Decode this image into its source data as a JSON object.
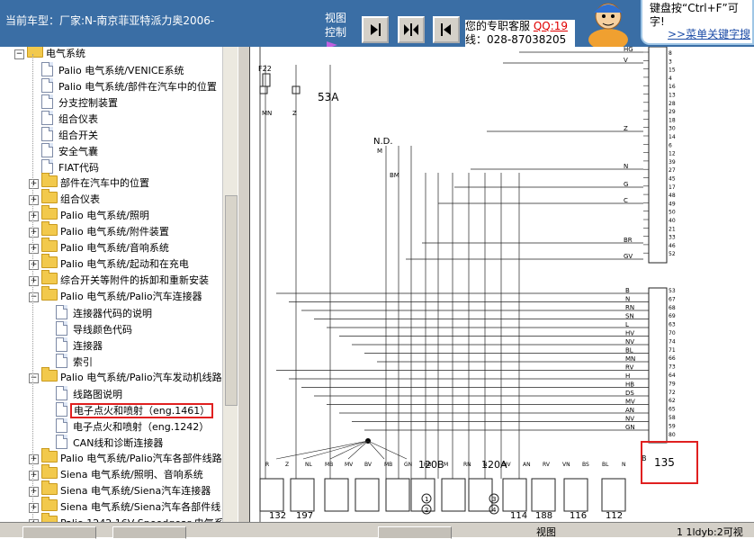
{
  "header": {
    "vehicle_label": "当前车型：厂家:N-南京菲亚特派力奥2006-",
    "view_control_label": "视图\n控制",
    "contact_line1": "您的专职客服",
    "contact_qq": "QQ:19",
    "contact_line2": "线：028-87038205",
    "help_text": "键盘按“Ctrl+F”可",
    "help_text2": "字!",
    "help_link": ">>菜单关键字搜"
  },
  "tree": [
    {
      "label": "电气系统",
      "type": "folder",
      "level": 0,
      "expanded": true
    },
    {
      "label": "Palio 电气系统/VENICE系统",
      "type": "doc",
      "level": 1
    },
    {
      "label": "Palio 电气系统/部件在汽车中的位置",
      "type": "doc",
      "level": 1
    },
    {
      "label": "分支控制装置",
      "type": "doc",
      "level": 1
    },
    {
      "label": "组合仪表",
      "type": "doc",
      "level": 1
    },
    {
      "label": "组合开关",
      "type": "doc",
      "level": 1
    },
    {
      "label": "安全气囊",
      "type": "doc",
      "level": 1
    },
    {
      "label": "FIAT代码",
      "type": "doc",
      "level": 1
    },
    {
      "label": "部件在汽车中的位置",
      "type": "folder",
      "level": 1,
      "expanded": false
    },
    {
      "label": "组合仪表",
      "type": "folder",
      "level": 1,
      "expanded": false
    },
    {
      "label": "Palio 电气系统/照明",
      "type": "folder",
      "level": 1,
      "expanded": false
    },
    {
      "label": "Palio 电气系统/附件装置",
      "type": "folder",
      "level": 1,
      "expanded": false
    },
    {
      "label": "Palio 电气系统/音响系统",
      "type": "folder",
      "level": 1,
      "expanded": false
    },
    {
      "label": "Palio 电气系统/起动和在充电",
      "type": "folder",
      "level": 1,
      "expanded": false
    },
    {
      "label": "综合开关等附件的拆卸和重新安装",
      "type": "folder",
      "level": 1,
      "expanded": false
    },
    {
      "label": "Palio 电气系统/Palio汽车连接器",
      "type": "folder",
      "level": 1,
      "expanded": true
    },
    {
      "label": "连接器代码的说明",
      "type": "doc",
      "level": 2
    },
    {
      "label": "导线颜色代码",
      "type": "doc",
      "level": 2
    },
    {
      "label": "连接器",
      "type": "doc",
      "level": 2
    },
    {
      "label": "索引",
      "type": "doc",
      "level": 2
    },
    {
      "label": "Palio 电气系统/Palio汽车发动机线路",
      "type": "folder",
      "level": 1,
      "expanded": true
    },
    {
      "label": "线路图说明",
      "type": "doc",
      "level": 2
    },
    {
      "label": "电子点火和喷射（eng.1461）",
      "type": "doc",
      "level": 2,
      "selected": true
    },
    {
      "label": "电子点火和喷射（eng.1242）",
      "type": "doc",
      "level": 2
    },
    {
      "label": "CAN线和诊断连接器",
      "type": "doc",
      "level": 2
    },
    {
      "label": "Palio 电气系统/Palio汽车各部件线路",
      "type": "folder",
      "level": 1,
      "expanded": false
    },
    {
      "label": "Siena 电气系统/照明、音响系统",
      "type": "folder",
      "level": 1,
      "expanded": false
    },
    {
      "label": "Siena 电气系统/Siena汽车连接器",
      "type": "folder",
      "level": 1,
      "expanded": false
    },
    {
      "label": "Siena 电气系统/Siena汽车各部件线",
      "type": "folder",
      "level": 1,
      "expanded": false
    },
    {
      "label": "Palio 1242 16V Speedgear 电气系",
      "type": "folder",
      "level": 1,
      "expanded": false
    }
  ],
  "diagram": {
    "labels_top": [
      "F22",
      "53A",
      "N.D.",
      "MN",
      "BM",
      "M",
      "Z"
    ],
    "wire_colors_right_upper": [
      "HG",
      "V",
      "Z",
      "N",
      "G",
      "C",
      "BR",
      "GV"
    ],
    "wire_colors_right_lower": [
      "B",
      "N",
      "RN",
      "SN",
      "L",
      "HV",
      "NV",
      "BL",
      "MN",
      "RV",
      "H",
      "HB",
      "DS",
      "MV",
      "AN",
      "NV",
      "GN"
    ],
    "pin_numbers_upper": [
      "8",
      "3",
      "15",
      "4",
      "16",
      "13",
      "28",
      "29",
      "18",
      "30",
      "14",
      "6",
      "12",
      "39",
      "27",
      "45",
      "17",
      "48",
      "49",
      "50",
      "40",
      "21",
      "33",
      "46",
      "52"
    ],
    "pin_numbers_lower": [
      "53",
      "67",
      "68",
      "69",
      "63",
      "70",
      "74",
      "71",
      "66",
      "73",
      "64",
      "79",
      "72",
      "62",
      "65",
      "58",
      "59",
      "80"
    ],
    "connector_box": "135",
    "bottom_components": [
      "132",
      "197",
      "120B",
      "120A",
      "114",
      "188",
      "116",
      "112"
    ],
    "bottom_wire_labels": [
      "R",
      "Z",
      "NL",
      "MB",
      "MV",
      "BV",
      "MB",
      "GN",
      "HB",
      "M",
      "RN",
      "N",
      "HV",
      "AN",
      "RV",
      "VN",
      "BS",
      "BL",
      "N"
    ],
    "marker_letter": "B",
    "circle_numbers": [
      "1",
      "2",
      "3",
      "4"
    ]
  },
  "bottombar": {
    "view_label": "视图",
    "page_info": "1 1ldyb:2可视"
  },
  "colors": {
    "topbar": "#3a6ea5",
    "highlight": "#e02020",
    "link": "#1f4ea8"
  }
}
